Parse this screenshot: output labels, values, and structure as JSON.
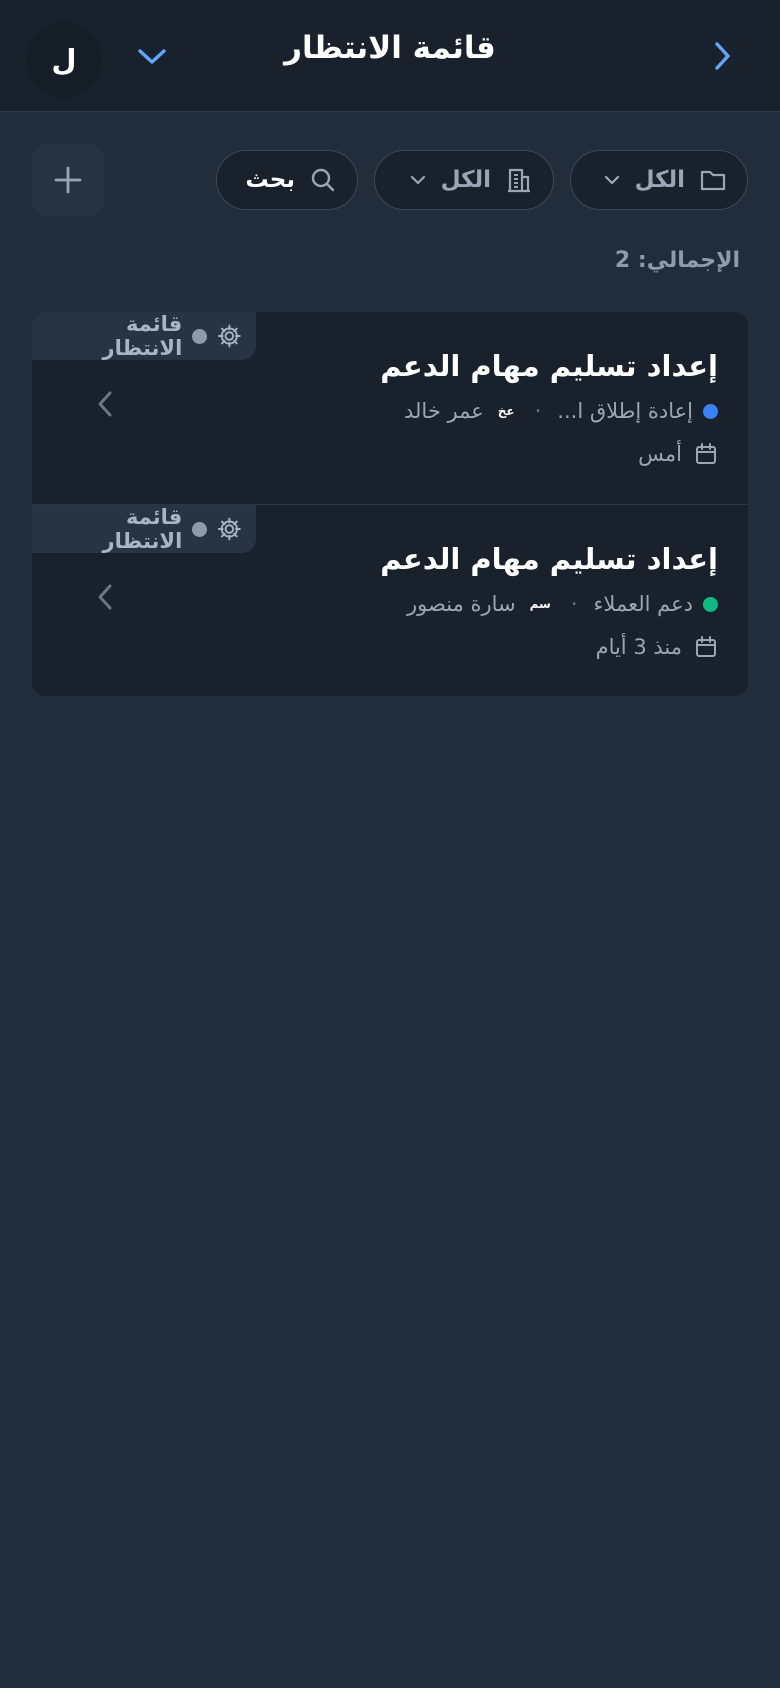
{
  "header": {
    "title": "قائمة الانتظار",
    "avatar_initial": "ل",
    "back_icon": "chevron-right-icon",
    "menu_icon": "chevron-down-icon"
  },
  "filters": {
    "folder": {
      "label": "الكل",
      "icon": "folder-icon"
    },
    "building": {
      "label": "الكل",
      "icon": "building-icon"
    },
    "search": {
      "label": "بحث",
      "icon": "search-icon"
    },
    "add_icon": "plus-icon"
  },
  "summary": {
    "total_label": "الإجمالي: 2"
  },
  "tasks": [
    {
      "badge": "قائمة الانتظار",
      "title": "إعداد تسليم مهام الدعم",
      "project": "إعادة إطلاق ا...",
      "project_color": "#3b82f6",
      "separator": "·",
      "assignee_initials": "عخ",
      "assignee": "عمر خالد",
      "date": "أمس"
    },
    {
      "badge": "قائمة الانتظار",
      "title": "إعداد تسليم مهام الدعم",
      "project": "دعم العملاء",
      "project_color": "#10b981",
      "separator": "·",
      "assignee_initials": "سم",
      "assignee": "سارة منصور",
      "date": "منذ 3 أيام"
    }
  ],
  "colors": {
    "background": "#222d3b",
    "header": "#18212c",
    "accent": "#60a5fa",
    "status_dot": "#8e9bab"
  }
}
